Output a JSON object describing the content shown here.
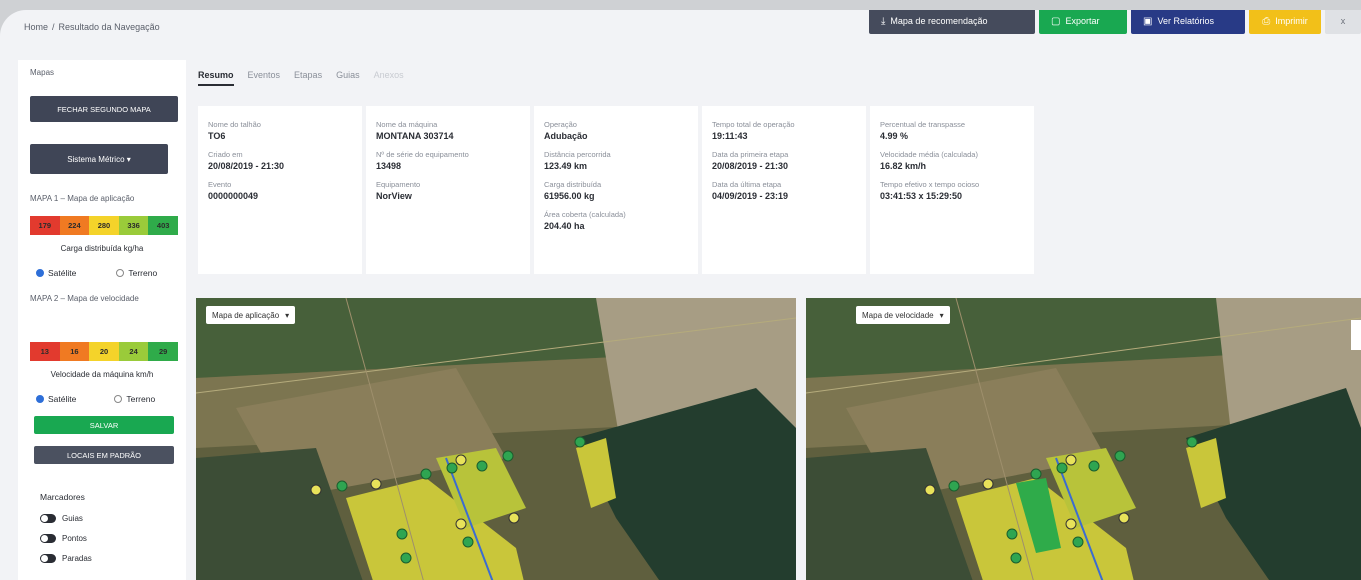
{
  "breadcrumb": {
    "home": "Home",
    "separator": "/",
    "current": "Resultado da Navegação"
  },
  "toolbar": {
    "recommendation": "Mapa de recomendação",
    "export": "Exportar",
    "reports": "Ver Relatórios",
    "print": "Imprimir",
    "close": "x",
    "icons": {
      "recommendation": "download-icon",
      "export": "file-icon",
      "reports": "report-icon",
      "print": "printer-icon"
    }
  },
  "sidebar": {
    "title": "Mapas",
    "close_second_map": "FECHAR SEGUNDO MAPA",
    "system": "Sistema Métrico",
    "map1_title": "MAPA 1 – Mapa de aplicação",
    "map1_legend": [
      {
        "value": "179",
        "color": "#e23a2e"
      },
      {
        "value": "224",
        "color": "#f07a22"
      },
      {
        "value": "280",
        "color": "#f4d32a"
      },
      {
        "value": "336",
        "color": "#9acb3a"
      },
      {
        "value": "403",
        "color": "#2fab4a"
      }
    ],
    "map1_caption": "Carga distribuída kg/ha",
    "radio_satellite": "Satélite",
    "radio_terrain": "Terreno",
    "map2_title": "MAPA 2 – Mapa de velocidade",
    "map2_legend": [
      {
        "value": "13",
        "color": "#e23a2e"
      },
      {
        "value": "16",
        "color": "#f07a22"
      },
      {
        "value": "20",
        "color": "#f4d32a"
      },
      {
        "value": "24",
        "color": "#9acb3a"
      },
      {
        "value": "29",
        "color": "#2fab4a"
      }
    ],
    "map2_caption": "Velocidade da máquina km/h",
    "green_button": "SALVAR",
    "gray_button": "LOCAIS EM PADRÃO",
    "markers_title": "Marcadores",
    "markers": [
      "Guias",
      "Pontos",
      "Paradas"
    ]
  },
  "tabs": [
    "Resumo",
    "Eventos",
    "Etapas",
    "Guias",
    "Anexos"
  ],
  "cards": [
    [
      {
        "label": "Nome do talhão",
        "value": "TO6"
      },
      {
        "label": "Criado em",
        "value": "20/08/2019 - 21:30"
      },
      {
        "label": "Evento",
        "value": "0000000049"
      }
    ],
    [
      {
        "label": "Nome da máquina",
        "value": "MONTANA 303714"
      },
      {
        "label": "Nº de série do equipamento",
        "value": "13498"
      },
      {
        "label": "Equipamento",
        "value": "NorView"
      }
    ],
    [
      {
        "label": "Operação",
        "value": "Adubação"
      },
      {
        "label": "Distância percorrida",
        "value": "123.49 km"
      },
      {
        "label": "Carga distribuída",
        "value": "61956.00 kg"
      },
      {
        "label": "Área coberta (calculada)",
        "value": "204.40 ha"
      }
    ],
    [
      {
        "label": "Tempo total de operação",
        "value": "19:11:43"
      },
      {
        "label": "Data da primeira etapa",
        "value": "20/08/2019 - 21:30"
      },
      {
        "label": "Data da última etapa",
        "value": "04/09/2019 - 23:19"
      }
    ],
    [
      {
        "label": "Percentual de transpasse",
        "value": "4.99 %"
      },
      {
        "label": "Velocidade média (calculada)",
        "value": "16.82 km/h"
      },
      {
        "label": "Tempo efetivo x tempo ocioso",
        "value": "03:41:53 x 15:29:50"
      }
    ]
  ],
  "maps": {
    "left_select": "Mapa de aplicação",
    "right_select": "Mapa de velocidade"
  }
}
